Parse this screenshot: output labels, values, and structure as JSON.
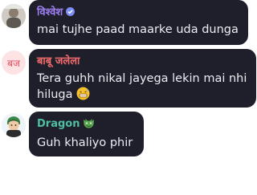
{
  "messages": [
    {
      "avatar_icon": "photo-avatar-icon",
      "name": "विश्वेश",
      "name_color": "#9d7ff1",
      "badge_icon": "verified-badge-icon",
      "badge_color": "#7a8ef5",
      "text": "mai tujhe paad maarke uda dunga"
    },
    {
      "avatar_text": "बज",
      "avatar_bg": "#fde3e4",
      "avatar_fg": "#e0505e",
      "name": "बाबू जलेला",
      "name_color": "#f16b6b",
      "text_line1": "Tera guhh nikal jayega lekin mai nhi",
      "text_line2": "hiluga",
      "emoji_icon": "grimacing-sweat-face-icon"
    },
    {
      "avatar_icon": "anime-character-avatar-icon",
      "name": "Dragon",
      "name_color": "#4fbfa0",
      "name_icon": "dragon-face-icon",
      "text": "Guh khaliyo phir"
    }
  ]
}
